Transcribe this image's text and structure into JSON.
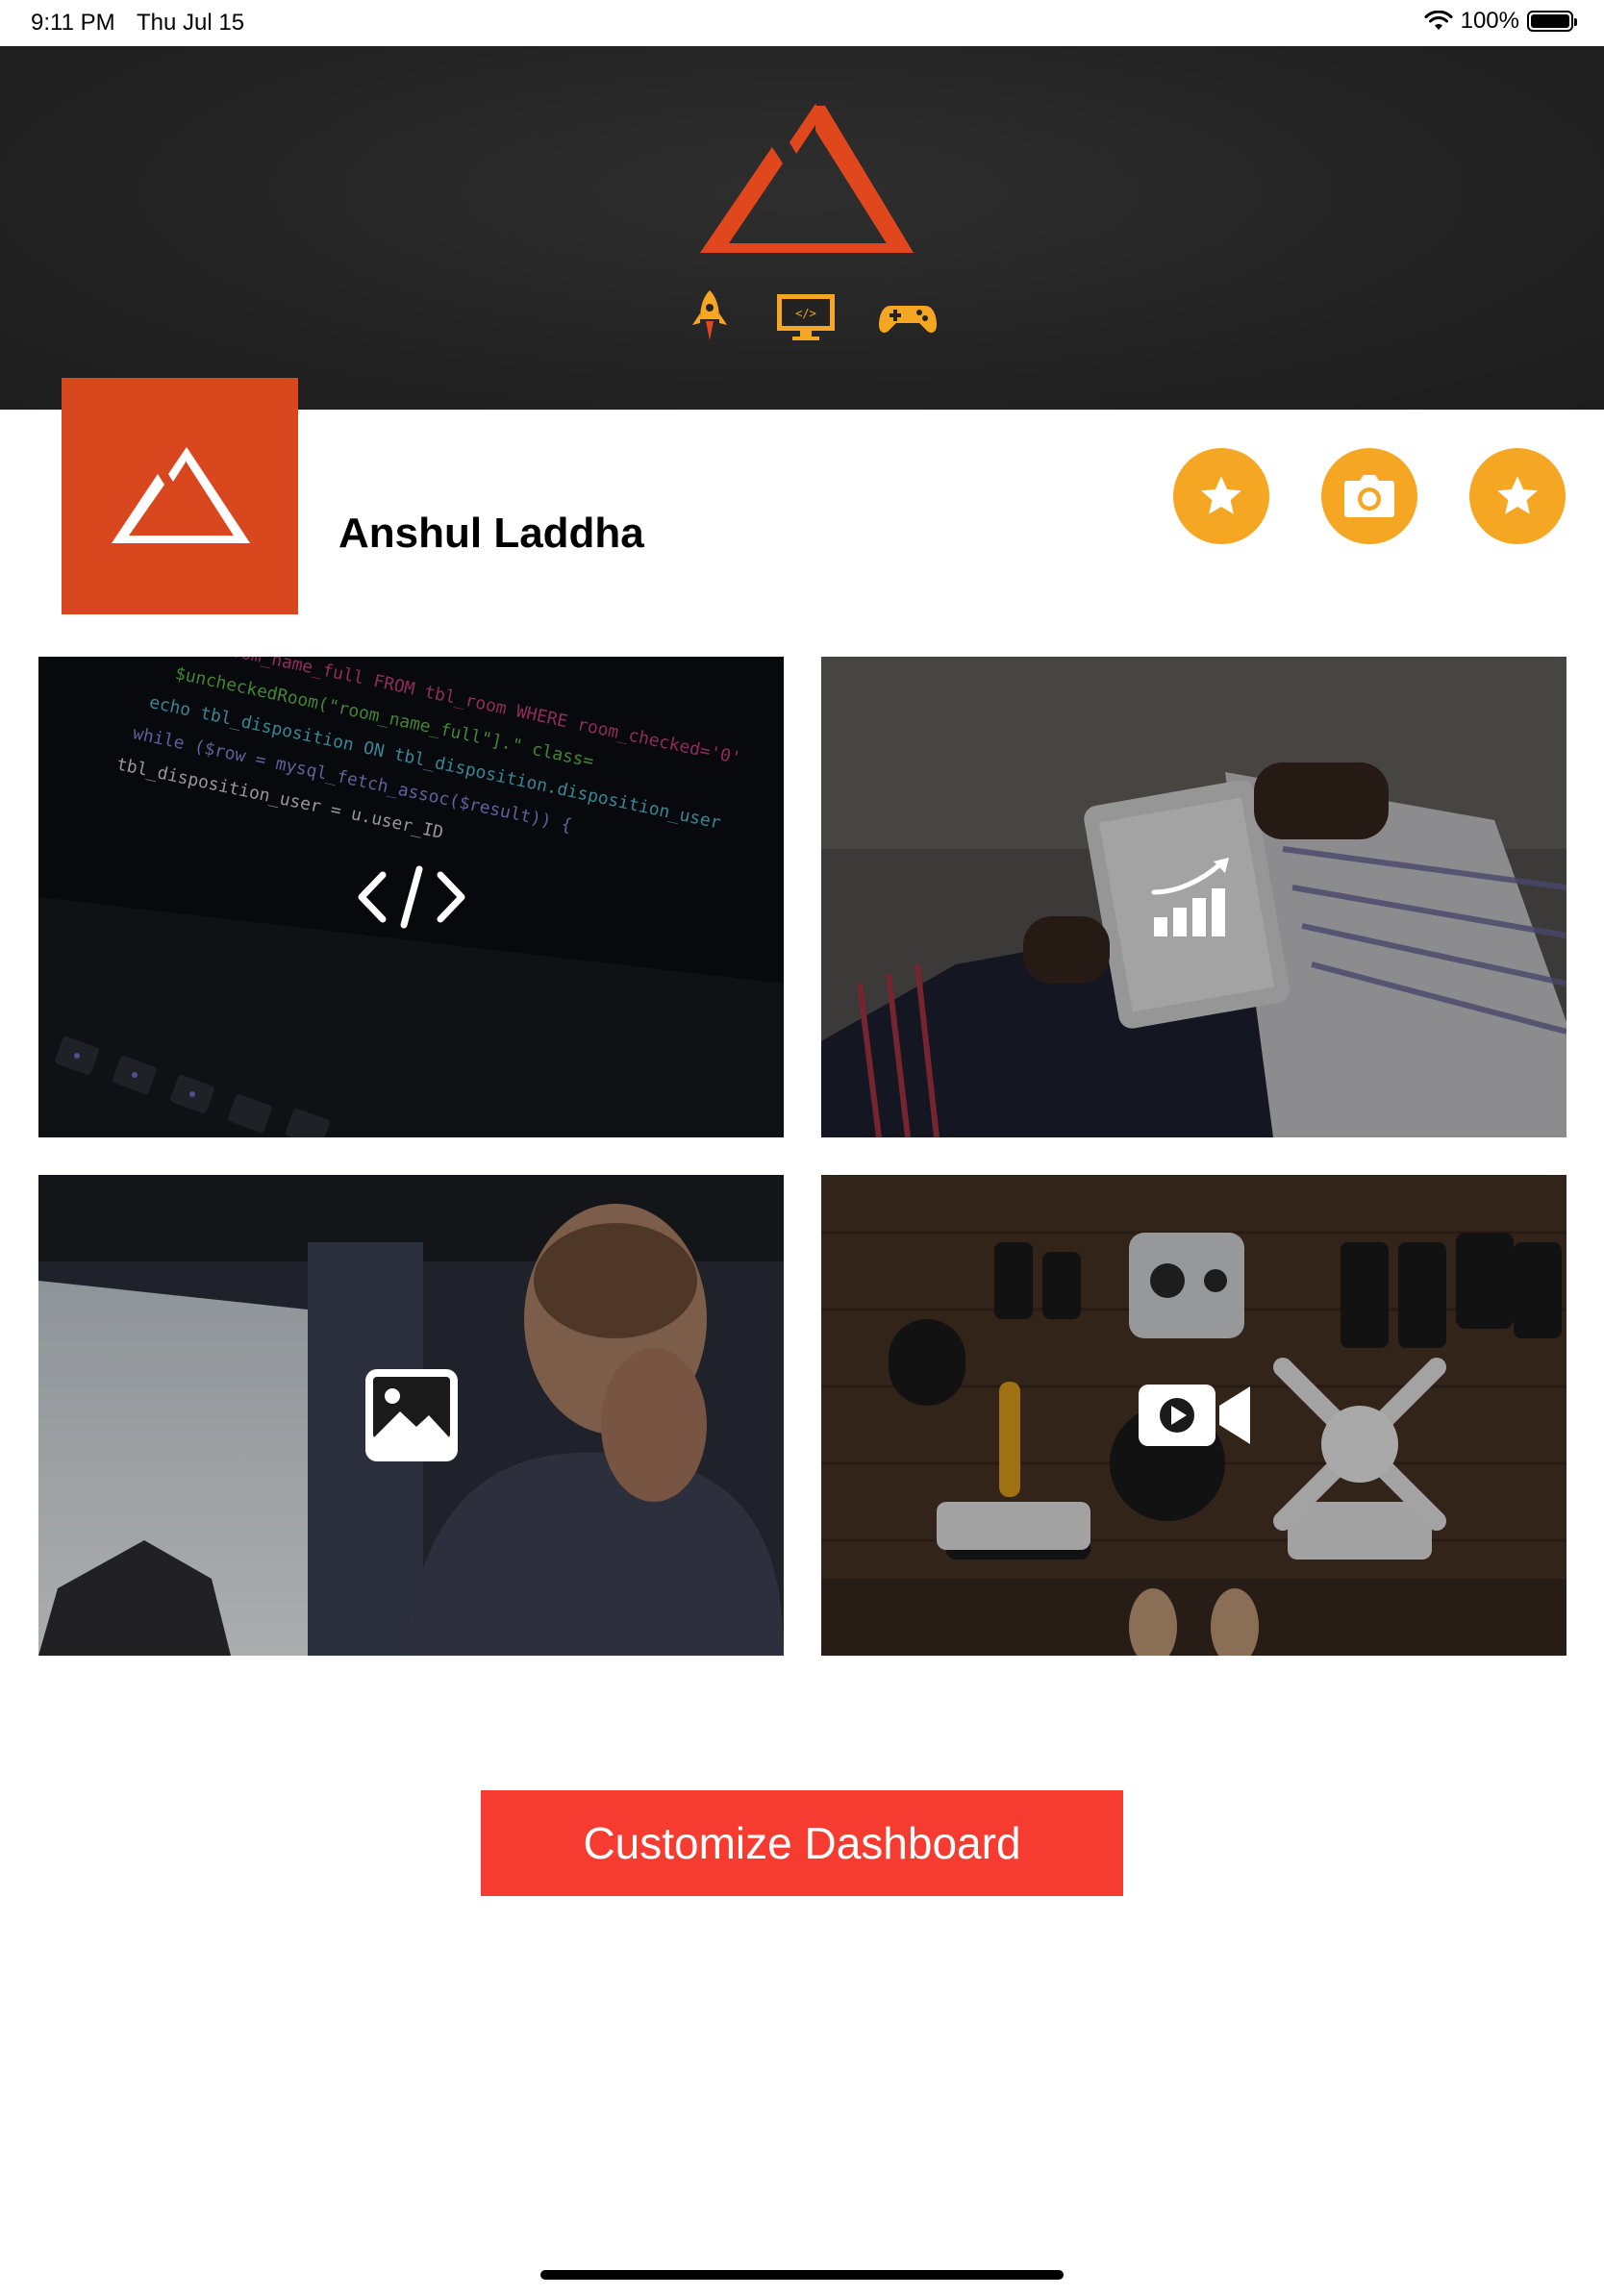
{
  "status_bar": {
    "time": "9:11 PM",
    "date": "Thu Jul 15",
    "battery": "100%",
    "icons": [
      "wifi-icon",
      "battery-icon"
    ]
  },
  "banner": {
    "logo": "mountain-logo",
    "icons": [
      "rocket-icon",
      "code-monitor-icon",
      "gamepad-icon"
    ],
    "accent_color": "#e0471d",
    "icon_color": "#f5a623"
  },
  "profile": {
    "name": "Anshul Laddha",
    "logo_bg": "#d9471f",
    "actions": [
      {
        "icon": "star-icon"
      },
      {
        "icon": "camera-icon"
      },
      {
        "icon": "star-icon"
      }
    ],
    "action_color": "#f5a623"
  },
  "tiles": [
    {
      "icon": "code-icon",
      "theme": "code on laptop"
    },
    {
      "icon": "analytics-icon",
      "theme": "tablet with charts"
    },
    {
      "icon": "photo-icon",
      "theme": "man thinking"
    },
    {
      "icon": "video-icon",
      "theme": "camera gear flat lay"
    }
  ],
  "customize_button": {
    "label": "Customize Dashboard",
    "color": "#f63b30"
  }
}
